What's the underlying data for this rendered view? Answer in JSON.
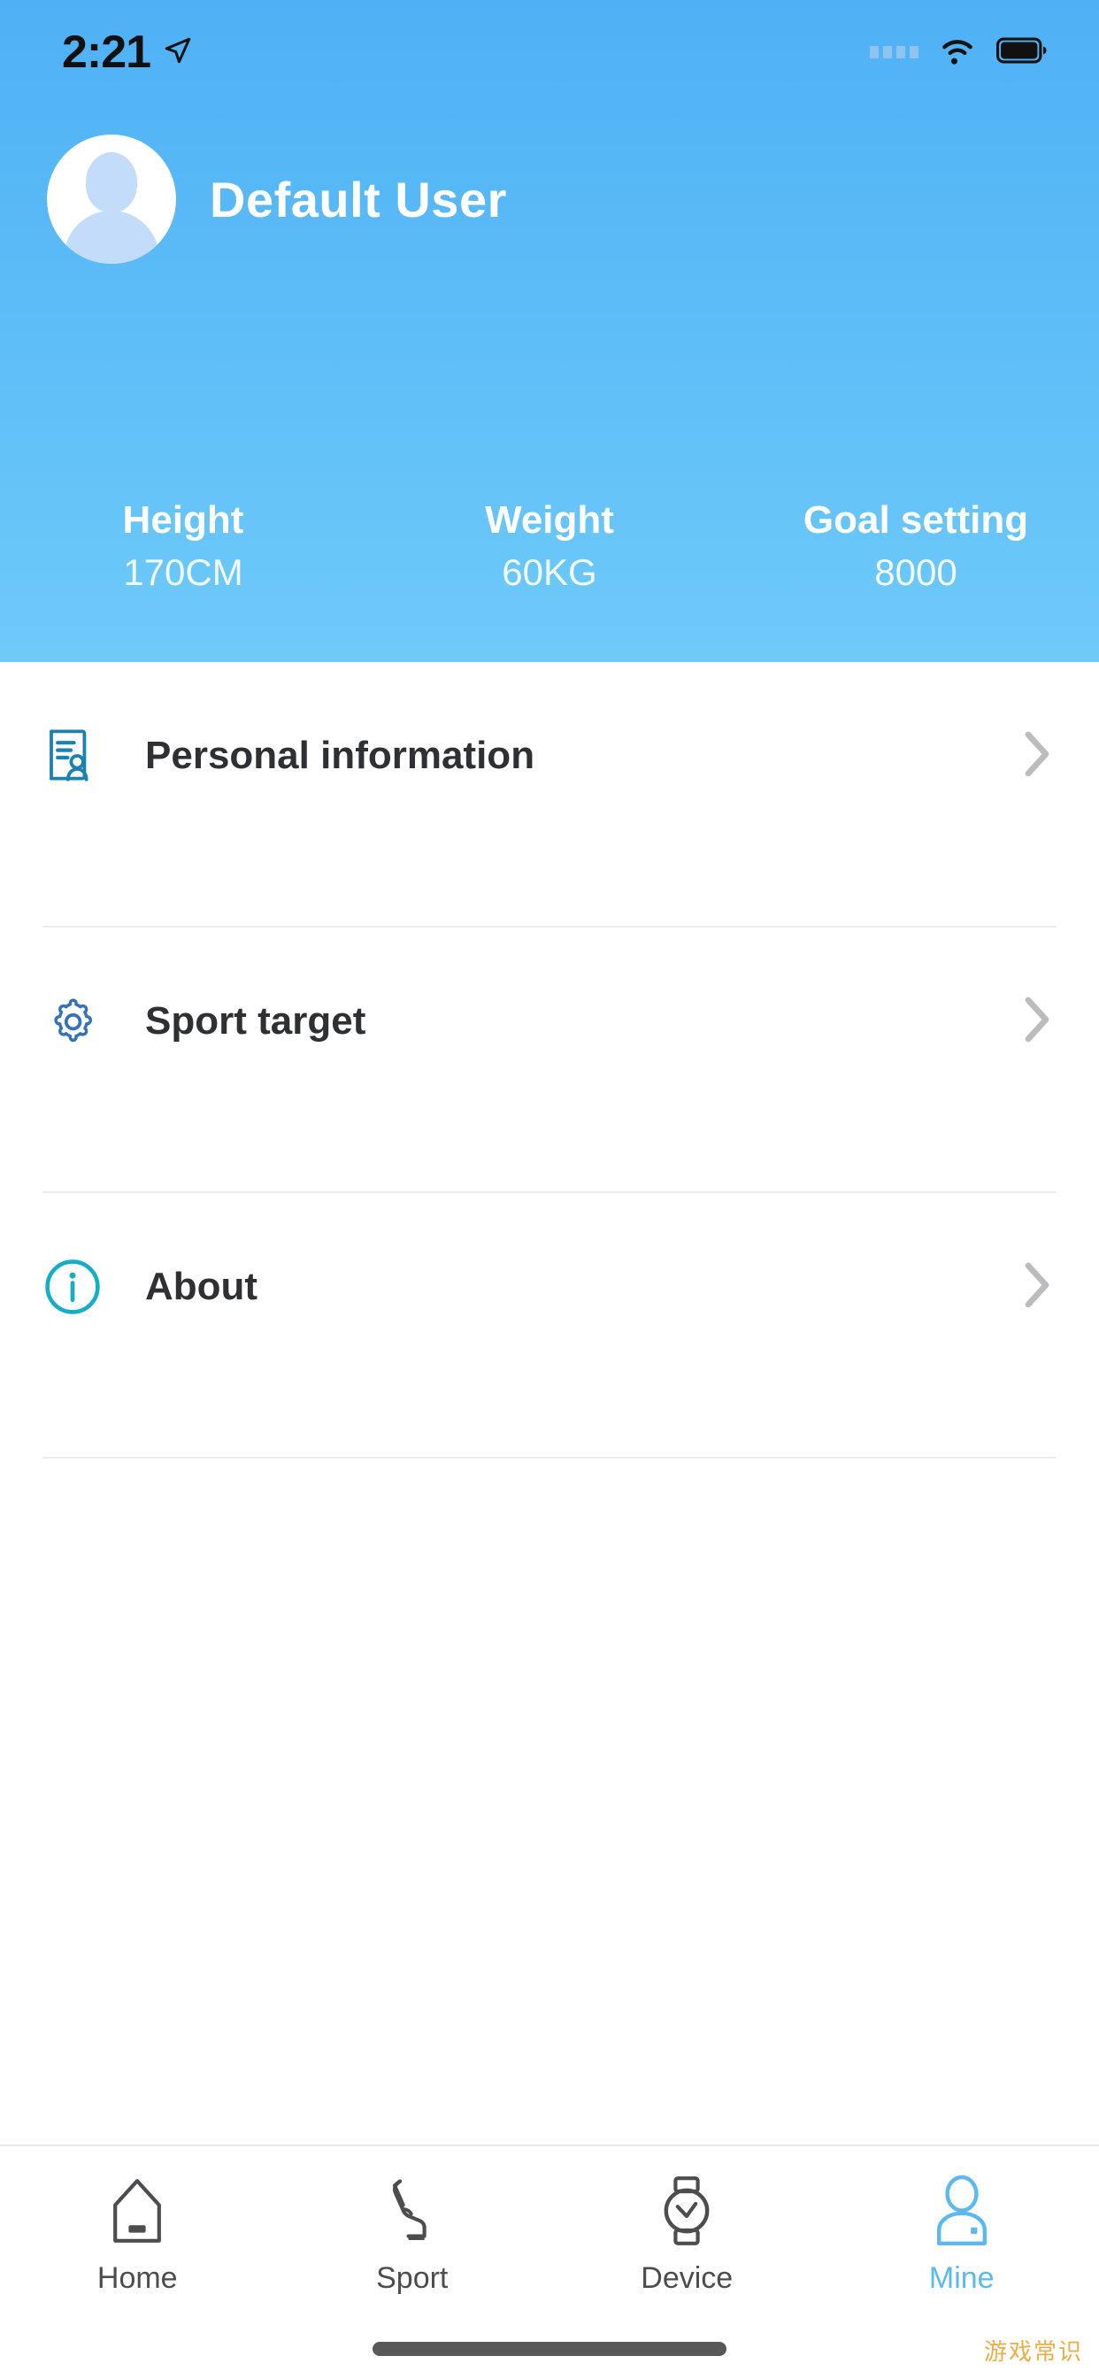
{
  "status_bar": {
    "time": "2:21",
    "location_icon": "location-arrow-icon",
    "signal_icon": "signal-dots-icon",
    "wifi_icon": "wifi-icon",
    "battery_icon": "battery-full-icon"
  },
  "header": {
    "avatar_icon": "default-avatar-icon",
    "username": "Default User",
    "stats": [
      {
        "label": "Height",
        "value": "170CM"
      },
      {
        "label": "Weight",
        "value": "60KG"
      },
      {
        "label": "Goal setting",
        "value": "8000"
      }
    ]
  },
  "menu": {
    "items": [
      {
        "label": "Personal information",
        "icon": "personal-info-icon",
        "chevron": "chevron-right-icon"
      },
      {
        "label": "Sport target",
        "icon": "gear-icon",
        "chevron": "chevron-right-icon"
      },
      {
        "label": "About",
        "icon": "info-circle-icon",
        "chevron": "chevron-right-icon"
      }
    ]
  },
  "tabbar": {
    "items": [
      {
        "label": "Home",
        "icon": "home-icon",
        "active": false
      },
      {
        "label": "Sport",
        "icon": "shoe-icon",
        "active": false
      },
      {
        "label": "Device",
        "icon": "watch-icon",
        "active": false
      },
      {
        "label": "Mine",
        "icon": "person-icon",
        "active": true
      }
    ]
  },
  "watermark": "游戏常识",
  "colors": {
    "header_top": "#4fb1f5",
    "header_bottom": "#6ecaf9",
    "accent": "#5bb8f0",
    "personal_icon": "#1a82ae",
    "gear_icon": "#3572b8",
    "info_icon": "#15aec4",
    "text": "#2f3033",
    "divider": "#ececee",
    "watermark": "#e8a535"
  }
}
